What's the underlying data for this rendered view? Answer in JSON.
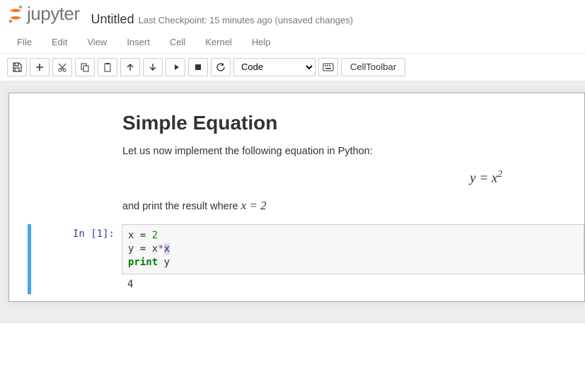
{
  "header": {
    "logo_text": "jupyter",
    "title": "Untitled",
    "checkpoint": "Last Checkpoint: 15 minutes ago (unsaved changes)"
  },
  "menubar": [
    "File",
    "Edit",
    "View",
    "Insert",
    "Cell",
    "Kernel",
    "Help"
  ],
  "toolbar": {
    "cell_type_selected": "Code",
    "celltoolbar_label": "CellToolbar"
  },
  "markdown": {
    "heading": "Simple Equation",
    "para1": "Let us now implement the following equation in Python:",
    "equation_rhs": "y = x²",
    "para2_prefix": "and print the result where ",
    "para2_eq": "x = 2"
  },
  "code_cell": {
    "prompt": "In [1]:",
    "line1_var": "x",
    "line1_eq": " = ",
    "line1_val": "2",
    "line2_var": "y",
    "line2_eq": " = ",
    "line2_rhs_a": "x",
    "line2_rhs_op": "*",
    "line2_rhs_b": "x",
    "line3_kw": "print",
    "line3_arg": " y",
    "output": "4"
  }
}
